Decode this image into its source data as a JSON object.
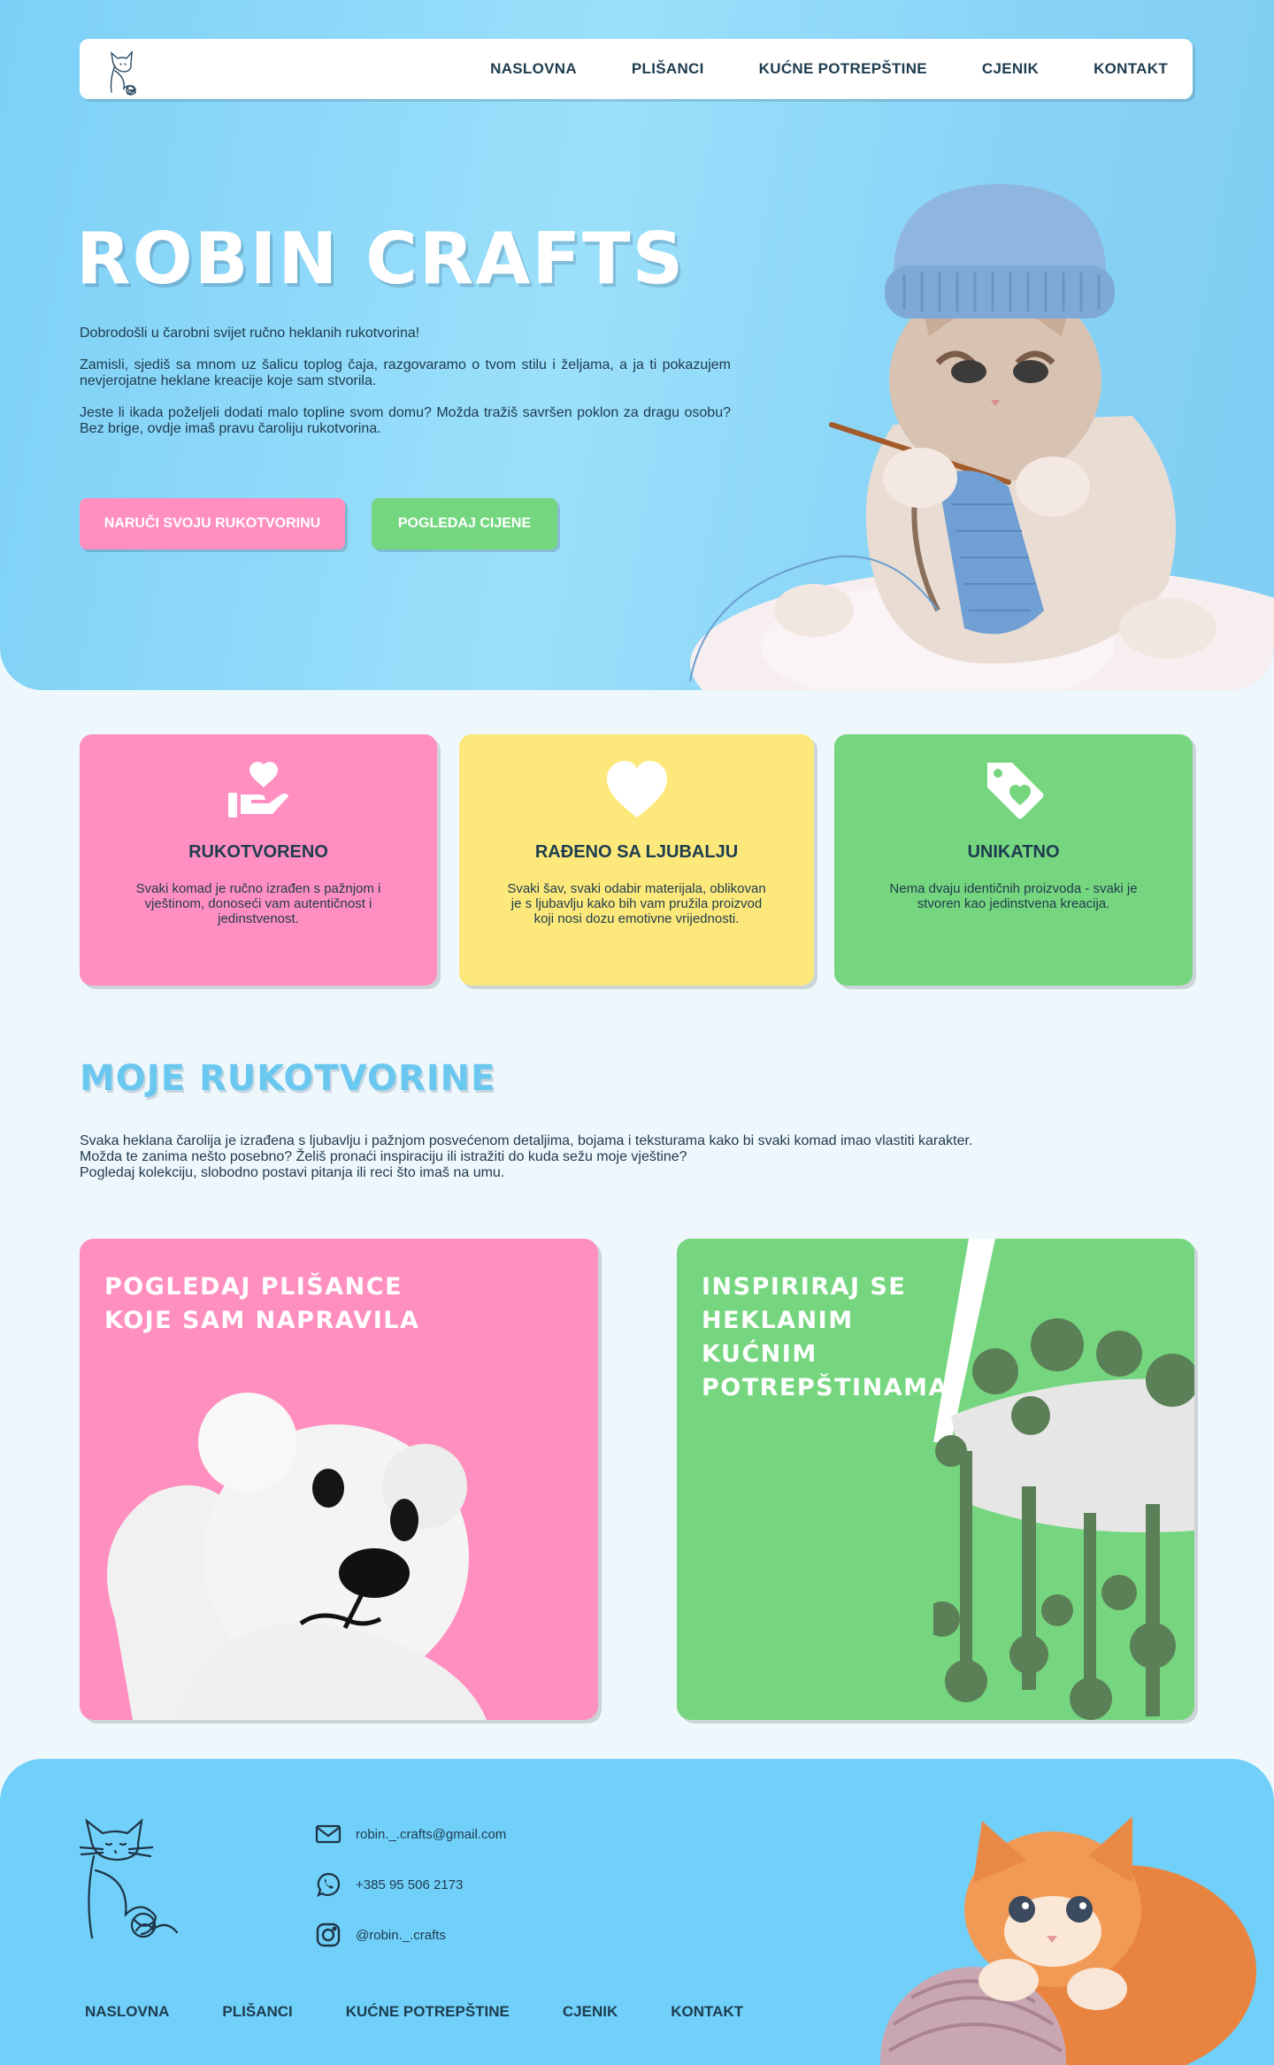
{
  "nav": {
    "items": [
      "NASLOVNA",
      "PLIŠANCI",
      "KUĆNE POTREPŠTINE",
      "CJENIK",
      "KONTAKT"
    ]
  },
  "hero": {
    "title": "ROBIN CRAFTS",
    "paragraphs": [
      "Dobrodošli u čarobni svijet ručno heklanih rukotvorina!",
      "Zamisli, sjediš sa mnom uz šalicu toplog čaja, razgovaramo o tvom stilu i željama, a ja ti pokazujem nevjerojatne heklane kreacije koje sam stvorila.",
      "Jeste li ikada poželjeli dodati malo topline svom domu? Možda tražiš savršen poklon za dragu osobu? Bez brige, ovdje imaš pravu čaroliju rukotvorina."
    ],
    "primary_button": "NARUČI SVOJU RUKOTVORINU",
    "secondary_button": "POGLEDAJ CIJENE"
  },
  "features": [
    {
      "icon": "hand-heart-icon",
      "title": "RUKOTVORENO",
      "text": "Svaki komad je ručno izrađen s pažnjom i vještinom, donoseći vam autentičnost i jedinstvenost."
    },
    {
      "icon": "heart-icon",
      "title": "RAĐENO SA LJUBALJU",
      "text": "Svaki šav, svaki odabir materijala, oblikovan je s ljubavlju kako bih vam pružila proizvod koji nosi dozu emotivne vrijednosti."
    },
    {
      "icon": "price-tag-heart-icon",
      "title": "UNIKATNO",
      "text": "Nema dvaju identičnih proizvoda - svaki je stvoren kao jedinstvena kreacija."
    }
  ],
  "crafts": {
    "title": "MOJE RUKOTVORINE",
    "lines": [
      "Svaka heklana čarolija je izrađena s ljubavlju i pažnjom posvećenom detaljima, bojama i teksturama kako bi svaki komad imao vlastiti karakter.",
      "Možda te zanima nešto posebno?  Želiš pronaći inspiraciju ili istražiti do kuda sežu moje vještine?",
      "Pogledaj kolekciju, slobodno postavi pitanja ili reci što imaš na umu."
    ],
    "tiles": [
      {
        "lines": [
          "POGLEDAJ PLIŠANCE",
          "KOJE SAM NAPRAVILA"
        ]
      },
      {
        "lines": [
          "INSPIRIRAJ SE",
          "HEKLANIM",
          "KUĆNIM",
          "POTREPŠTINAMA"
        ]
      }
    ]
  },
  "footer": {
    "email": "robin._.crafts@gmail.com",
    "phone": "+385 95 506 2173",
    "instagram": "@robin._.crafts",
    "nav": [
      "NASLOVNA",
      "PLIŠANCI",
      "KUĆNE POTREPŠTINE",
      "CJENIK",
      "KONTAKT"
    ]
  },
  "colors": {
    "sky": "#7dd0f7",
    "pink": "#ff8fbf",
    "yellow": "#fde97b",
    "green": "#76d67f",
    "text": "#1f3a4d"
  }
}
